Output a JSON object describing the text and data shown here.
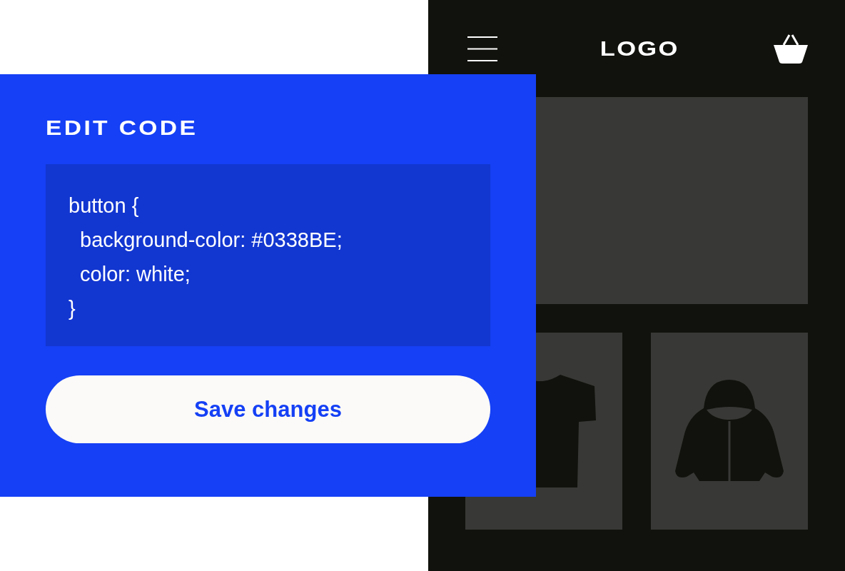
{
  "shop": {
    "logo": "LOGO"
  },
  "editor": {
    "title": "EDIT CODE",
    "code_lines": [
      "button {",
      "  background-color: #0338BE;",
      "  color: white;",
      "}"
    ],
    "button": "Save changes"
  }
}
